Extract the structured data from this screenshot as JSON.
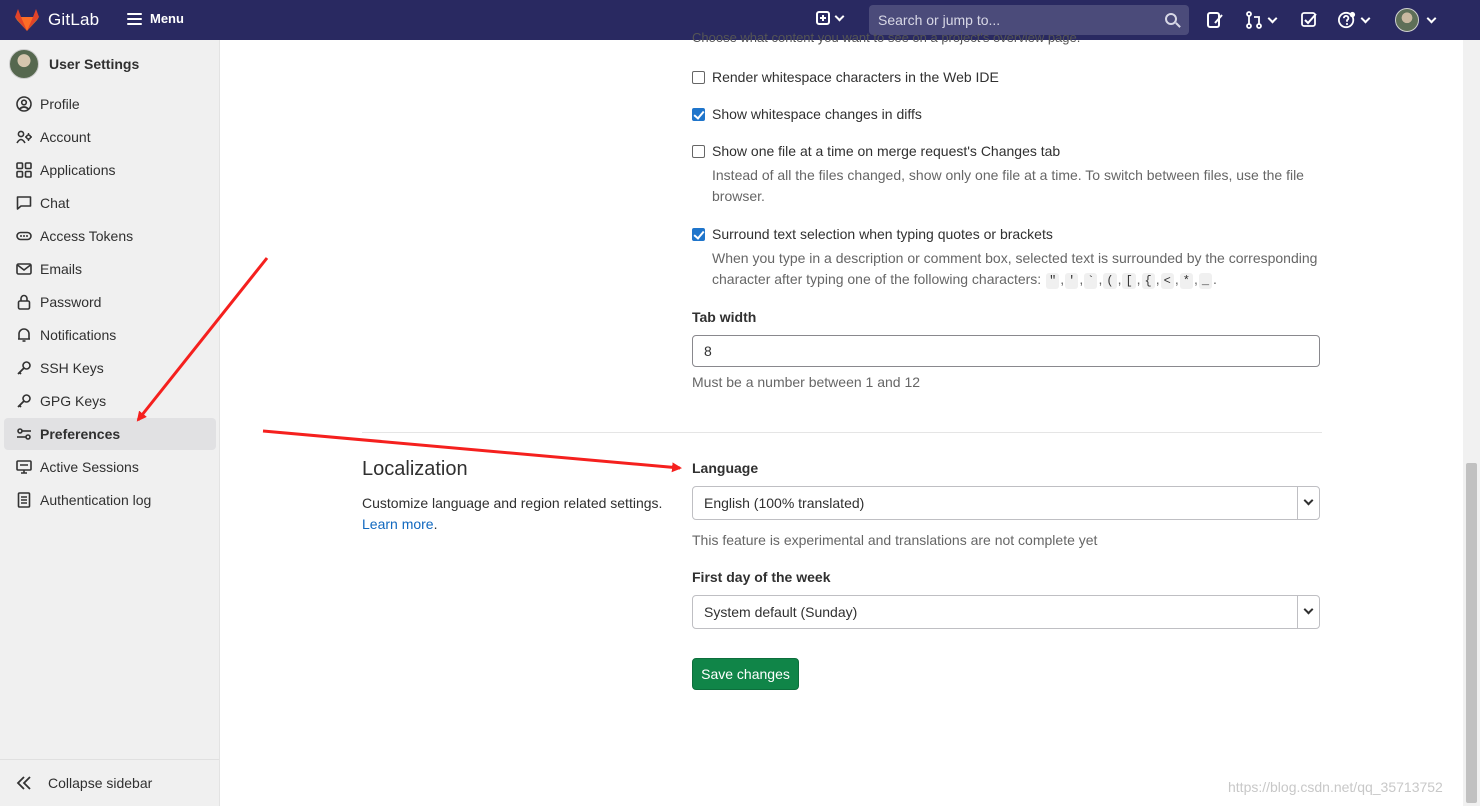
{
  "navbar": {
    "brand": "GitLab",
    "menu_label": "Menu",
    "search_placeholder": "Search or jump to...",
    "icons": [
      "new-item-icon",
      "issues-icon",
      "merge-requests-icon",
      "todo-icon",
      "help-icon"
    ]
  },
  "sidebar": {
    "title": "User Settings",
    "items": [
      {
        "label": "Profile",
        "icon": "profile-icon"
      },
      {
        "label": "Account",
        "icon": "account-icon"
      },
      {
        "label": "Applications",
        "icon": "applications-icon"
      },
      {
        "label": "Chat",
        "icon": "chat-icon"
      },
      {
        "label": "Access Tokens",
        "icon": "token-icon"
      },
      {
        "label": "Emails",
        "icon": "mail-icon"
      },
      {
        "label": "Password",
        "icon": "lock-icon"
      },
      {
        "label": "Notifications",
        "icon": "bell-icon"
      },
      {
        "label": "SSH Keys",
        "icon": "key-icon"
      },
      {
        "label": "GPG Keys",
        "icon": "key-icon"
      },
      {
        "label": "Preferences",
        "icon": "preferences-icon"
      },
      {
        "label": "Active Sessions",
        "icon": "monitor-icon"
      },
      {
        "label": "Authentication log",
        "icon": "log-icon"
      }
    ],
    "active_item": "Preferences",
    "collapse_label": "Collapse sidebar"
  },
  "main": {
    "cut_text": "Choose what content you want to see on a project's overview page.",
    "checkboxes": [
      {
        "label": "Render whitespace characters in the Web IDE",
        "checked": false
      },
      {
        "label": "Show whitespace changes in diffs",
        "checked": true
      },
      {
        "label": "Show one file at a time on merge request's Changes tab",
        "checked": false,
        "help": "Instead of all the files changed, show only one file at a time. To switch between files, use the file browser."
      },
      {
        "label": "Surround text selection when typing quotes or brackets",
        "checked": true,
        "help": "When you type in a description or comment box, selected text is surrounded by the corresponding character after typing one of the following characters:"
      }
    ],
    "surround_chars": [
      "\"",
      "'",
      "`",
      "(",
      "[",
      "{",
      "<",
      "*",
      "_"
    ],
    "tab_width": {
      "label": "Tab width",
      "value": "8",
      "help": "Must be a number between 1 and 12"
    },
    "localization": {
      "title": "Localization",
      "description": "Customize language and region related settings.",
      "learn_more": "Learn more",
      "language": {
        "label": "Language",
        "value": "English (100% translated)",
        "help": "This feature is experimental and translations are not complete yet"
      },
      "first_day": {
        "label": "First day of the week",
        "value": "System default (Sunday)"
      }
    },
    "save_label": "Save changes"
  },
  "watermark": "https://blog.csdn.net/qq_35713752",
  "colors": {
    "navbar": "#292961",
    "save": "#108548",
    "link": "#1068bf",
    "checkbox": "#1f75cb",
    "arrow": "#f5201e"
  }
}
